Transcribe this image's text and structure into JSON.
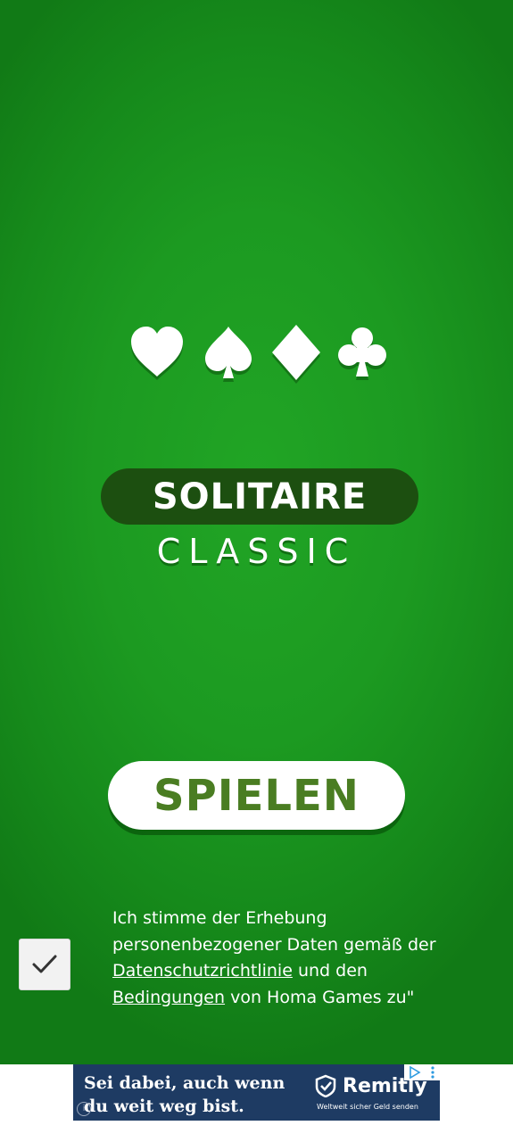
{
  "colors": {
    "felt": "#1c9a21",
    "title_pill": "#1c4f10",
    "play_text": "#4a7d22",
    "ad_background": "#1e3b63"
  },
  "suits": [
    {
      "name": "heart-icon"
    },
    {
      "name": "spade-icon"
    },
    {
      "name": "diamond-icon"
    },
    {
      "name": "club-icon"
    }
  ],
  "logo": {
    "title": "SOLITAIRE",
    "subtitle": "CLASSIC"
  },
  "play_button": {
    "label": "SPIELEN"
  },
  "consent": {
    "checked": true,
    "text_part1": "Ich stimme der Erhebung personenbezogener Daten gemäß der ",
    "privacy_link": "Datenschutzrichtlinie",
    "text_part2": " und den ",
    "terms_link": "Bedingungen",
    "text_part3": " von Homa Games zu\""
  },
  "ad": {
    "headline_line1": "Sei dabei, auch wenn",
    "headline_line2": "du weit weg bist.",
    "brand": "Remitly",
    "tagline": "Weltweit sicher Geld senden",
    "choices_icon": "adchoices-icon",
    "menu_icon": "more-vert-icon"
  }
}
